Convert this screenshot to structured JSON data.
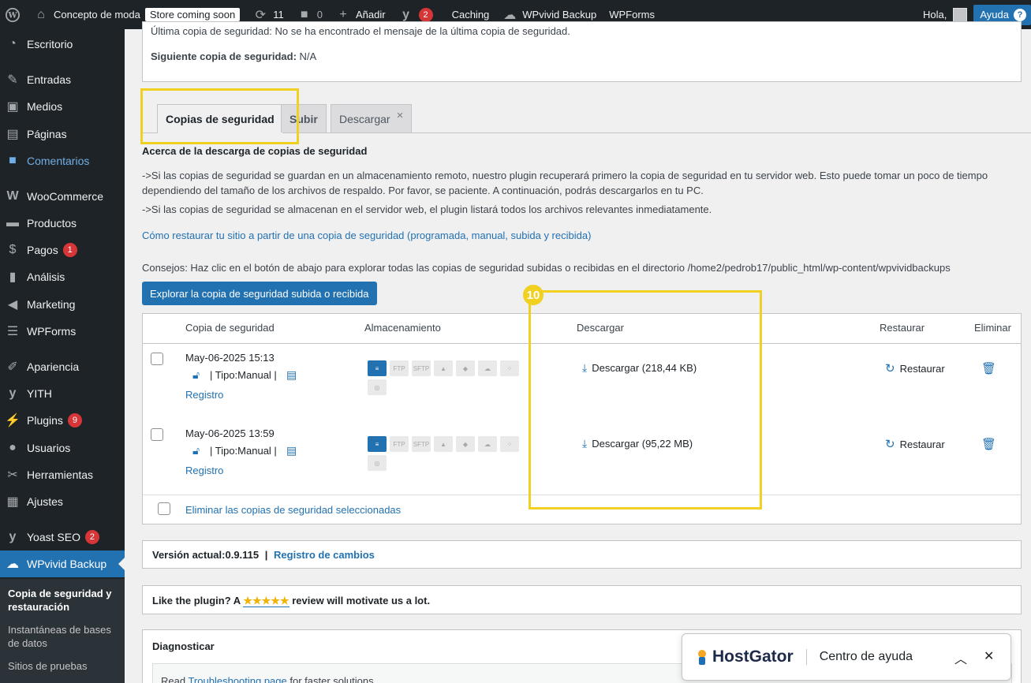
{
  "adminbar": {
    "site_name": "Concepto de moda",
    "store_pill": "Store coming soon",
    "updates_count": "11",
    "comments_count": "0",
    "add_label": "Añadir",
    "yoast_badge": "2",
    "caching": "Caching",
    "wpvivid": "WPvivid Backup",
    "wpforms": "WPForms",
    "greeting": "Hola,",
    "help": "Ayuda"
  },
  "sidebar": {
    "items": [
      {
        "label": "Escritorio"
      },
      {
        "label": "Entradas"
      },
      {
        "label": "Medios"
      },
      {
        "label": "Páginas"
      },
      {
        "label": "Comentarios"
      },
      {
        "label": "WooCommerce"
      },
      {
        "label": "Productos"
      },
      {
        "label": "Pagos",
        "badge": "1"
      },
      {
        "label": "Análisis"
      },
      {
        "label": "Marketing"
      },
      {
        "label": "WPForms"
      },
      {
        "label": "Apariencia"
      },
      {
        "label": "YITH"
      },
      {
        "label": "Plugins",
        "badge": "9"
      },
      {
        "label": "Usuarios"
      },
      {
        "label": "Herramientas"
      },
      {
        "label": "Ajustes"
      },
      {
        "label": "Yoast SEO",
        "badge": "2"
      },
      {
        "label": "WPvivid Backup"
      }
    ],
    "submenu": [
      {
        "label": "Copia de seguridad y restauración"
      },
      {
        "label": "Instantáneas de bases de datos"
      },
      {
        "label": "Sitios de pruebas"
      }
    ]
  },
  "top_box": {
    "last_backup": "Última copia de seguridad: No se ha encontrado el mensaje de la última copia de seguridad.",
    "next_label": "Siguiente copia de seguridad:",
    "next_value": "N/A"
  },
  "tabs": {
    "backups": "Copias de seguridad",
    "upload": "Subir",
    "download": "Descargar",
    "close": "×"
  },
  "about": {
    "heading": "Acerca de la descarga de copias de seguridad",
    "line1": "->Si las copias de seguridad se guardan en un almacenamiento remoto, nuestro plugin recuperará primero la copia de seguridad en tu servidor web. Esto puede tomar un poco de tiempo",
    "line2": "dependiendo del tamaño de los archivos de respaldo. Por favor, se paciente. A continuación, podrás descargarlos en tu PC.",
    "line3": "->Si las copias de seguridad se almacenan en el servidor web, el plugin listará todos los archivos relevantes inmediatamente.",
    "restore_link": "Cómo restaurar tu sitio a partir de una copia de seguridad (programada, manual, subida y recibida)",
    "tip": "Consejos: Haz clic en el botón de abajo para explorar todas las copias de seguridad subidas o recibidas en el directorio /home2/pedrob17/public_html/wp-content/wpvividbackups",
    "explore_button": "Explorar la copia de seguridad subida o recibida"
  },
  "table": {
    "headers": {
      "backup": "Copia de seguridad",
      "storage": "Almacenamiento",
      "download": "Descargar",
      "restore": "Restaurar",
      "delete": "Eliminar"
    },
    "rows": [
      {
        "date": "May-06-2025 15:13",
        "type": "| Tipo:Manual |",
        "log": "Registro",
        "download": "Descargar (218,44 KB)",
        "restore": "Restaurar"
      },
      {
        "date": "May-06-2025 13:59",
        "type": "| Tipo:Manual |",
        "log": "Registro",
        "download": "Descargar (95,22 MB)",
        "restore": "Restaurar"
      }
    ],
    "delete_selected": "Eliminar las copias de seguridad seleccionadas"
  },
  "storage_icons": [
    "server-icon",
    "ftp-icon",
    "sftp-icon",
    "google-drive-icon",
    "dropbox-icon",
    "onedrive-icon",
    "s3-icon",
    "digitalocean-icon"
  ],
  "storage_labels": {
    "ftp": "FTP",
    "sftp": "SFTP"
  },
  "annotation": {
    "step": "10"
  },
  "version": {
    "label": "Versión actual:0.9.115",
    "sep": "|",
    "changelog": "Registro de cambios"
  },
  "review": {
    "text_before": "Like the plugin? A",
    "stars": "★★★★★",
    "text_after": "review will motivate us a lot."
  },
  "diagnose": {
    "title": "Diagnosticar",
    "read": "Read",
    "troubleshooting": "Troubleshooting page",
    "rest": "for faster solutions."
  },
  "hostgator": {
    "logo": "HostGator",
    "title": "Centro de ayuda"
  },
  "colors": {
    "accent": "#2271b1",
    "highlight": "#f0d020",
    "admin_bg": "#1d2327"
  }
}
